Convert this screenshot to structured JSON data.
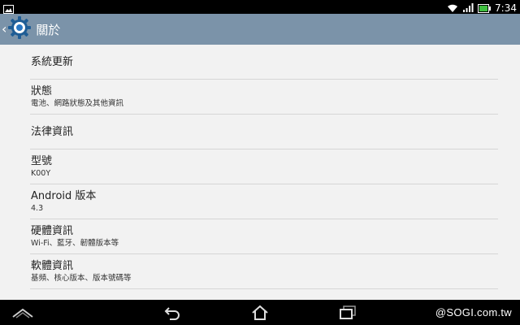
{
  "status_bar": {
    "time": "7:34",
    "icons": [
      "notification-image-icon",
      "wifi-icon",
      "signal-icon",
      "battery-icon"
    ],
    "battery_color": "#3fbf3f"
  },
  "action_bar": {
    "title": "關於",
    "icon": "settings-gear-icon",
    "color": "#7b93a9"
  },
  "items": [
    {
      "title": "系統更新",
      "subtitle": ""
    },
    {
      "title": "狀態",
      "subtitle": "電池、網路狀態及其他資訊"
    },
    {
      "title": "法律資訊",
      "subtitle": ""
    },
    {
      "title": "型號",
      "subtitle": "K00Y"
    },
    {
      "title": "Android 版本",
      "subtitle": "4.3"
    },
    {
      "title": "硬體資訊",
      "subtitle": "Wi-Fi、藍牙、韌體版本等"
    },
    {
      "title": "軟體資訊",
      "subtitle": "基頻、核心版本、版本號碼等"
    }
  ],
  "nav_bar": {
    "buttons": [
      "collapse-up-icon",
      "back-icon",
      "home-icon",
      "recent-apps-icon"
    ],
    "watermark": "@SOGI.com.tw"
  }
}
